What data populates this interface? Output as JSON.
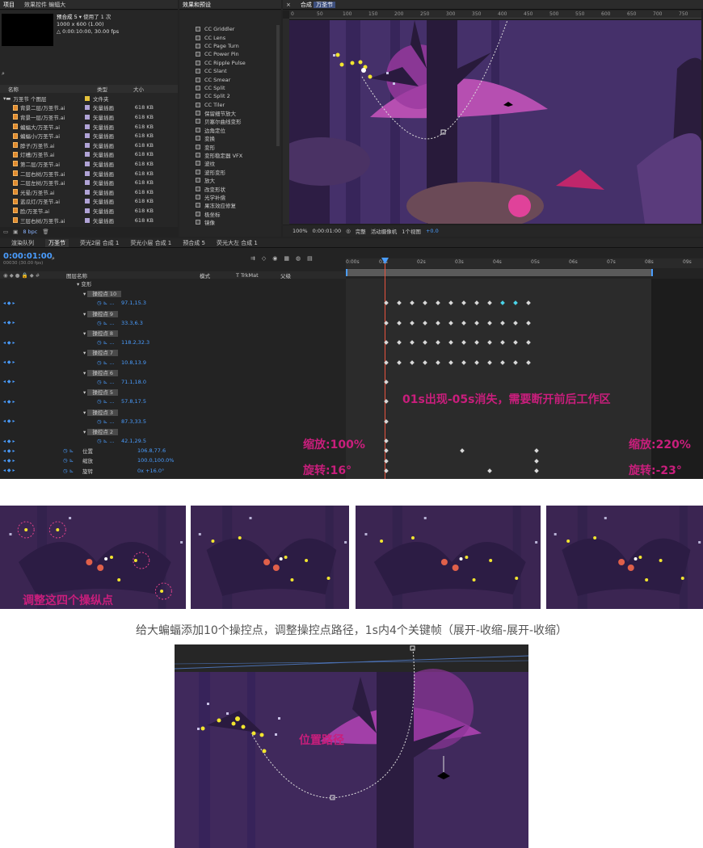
{
  "project_panel": {
    "tabs": [
      "项目",
      "效果控件 蝙蝠大"
    ],
    "preview_title": "预合成 5",
    "preview_used": "使用了 1 次",
    "preview_size": "1000 x 600 (1.00)",
    "preview_duration": "△ 0:00:10:00, 30.00 fps",
    "col_name": "名称",
    "col_type": "类型",
    "col_size": "大小",
    "bpc": "8 bpc",
    "items": [
      {
        "name": "万圣节 个图层",
        "type": "文件夹",
        "size": ""
      },
      {
        "name": "背景二层/万圣节.ai",
        "type": "矢量插画",
        "size": "618 KB"
      },
      {
        "name": "背景一层/万圣节.ai",
        "type": "矢量插画",
        "size": "618 KB"
      },
      {
        "name": "蝙蝠大/万圣节.ai",
        "type": "矢量插画",
        "size": "618 KB"
      },
      {
        "name": "蝙蝠小/万圣节.ai",
        "type": "矢量插画",
        "size": "618 KB"
      },
      {
        "name": "脖子/万圣节.ai",
        "type": "矢量插画",
        "size": "618 KB"
      },
      {
        "name": "灯槽/万圣节.ai",
        "type": "矢量插画",
        "size": "618 KB"
      },
      {
        "name": "第二层/万圣节.ai",
        "type": "矢量插画",
        "size": "618 KB"
      },
      {
        "name": "二层右树/万圣节.ai",
        "type": "矢量插画",
        "size": "618 KB"
      },
      {
        "name": "二层左树/万圣节.ai",
        "type": "矢量插画",
        "size": "618 KB"
      },
      {
        "name": "光晕/万圣节.ai",
        "type": "矢量插画",
        "size": "618 KB"
      },
      {
        "name": "蓝瓜灯/万圣节.ai",
        "type": "矢量插画",
        "size": "618 KB"
      },
      {
        "name": "脸/万圣节.ai",
        "type": "矢量插画",
        "size": "618 KB"
      },
      {
        "name": "三层右树/万圣节.ai",
        "type": "矢量插画",
        "size": "618 KB"
      }
    ]
  },
  "effects_panel": {
    "title": "效果和预设",
    "items": [
      "CC Griddler",
      "CC Lens",
      "CC Page Turn",
      "CC Power Pin",
      "CC Ripple Pulse",
      "CC Slant",
      "CC Smear",
      "CC Split",
      "CC Split 2",
      "CC Tiler",
      "保留细节放大",
      "贝塞尔曲线变形",
      "边角定位",
      "变换",
      "变形",
      "变形稳定器 VFX",
      "波纹",
      "波形变形",
      "放大",
      "改变形状",
      "光学补偿",
      "果冻效应修复",
      "极坐标",
      "镜像"
    ]
  },
  "comp_panel": {
    "tab_label": "合成",
    "comp_name": "万圣节",
    "ruler": [
      "0",
      "50",
      "100",
      "150",
      "200",
      "250",
      "300",
      "350",
      "400",
      "450",
      "500",
      "550",
      "600",
      "650",
      "700",
      "750"
    ],
    "zoom": "100%",
    "timecode": "0:00:01:00",
    "quality": "完整",
    "camera": "活动摄像机",
    "views": "1个视图",
    "exposure": "+0.0"
  },
  "timeline": {
    "tabs": [
      "渲染队列",
      "万圣节",
      "荧光2层 合成 1",
      "荧光小层 合成 1",
      "预合成 5",
      "荧光大左 合成 1"
    ],
    "active_tab": "万圣节",
    "timecode": "0:00:01:00",
    "frame": "00030 (30.00 fps)",
    "col_layer": "图层名称",
    "col_mode": "模式",
    "col_trkmat": "T TrkMat",
    "col_parent": "父级",
    "time_ticks": [
      "0:00s",
      "01s",
      "02s",
      "03s",
      "04s",
      "05s",
      "06s",
      "07s",
      "08s",
      "09s"
    ],
    "transform_label": "变形",
    "rows": [
      {
        "label": "操控点 10",
        "value": "97.1,15.3"
      },
      {
        "label": "操控点 9",
        "value": "33.3,6.3"
      },
      {
        "label": "操控点 8",
        "value": "118.2,32.3"
      },
      {
        "label": "操控点 7",
        "value": "10.8,13.9"
      },
      {
        "label": "操控点 6",
        "value": "71.1,18.0"
      },
      {
        "label": "操控点 5",
        "value": "57.8,17.5"
      },
      {
        "label": "操控点 3",
        "value": "87.3,33.5"
      },
      {
        "label": "操控点 2",
        "value": "42.1,29.5"
      }
    ],
    "position_label": "位置",
    "position_value": "106.8,77.6",
    "scale_label": "缩放",
    "scale_value": "100.0,100.0%",
    "rotation_label": "旋转",
    "rotation_value": "0x +16.0°"
  },
  "annotations": {
    "work_area": "01s出现-05s消失，需要断开前后工作区",
    "scale_start": "缩放:100%",
    "rotate_start": "旋转:16°",
    "scale_end": "缩放:220%",
    "rotate_end": "旋转:-23°",
    "adjust_points": "调整这四个操纵点",
    "caption": "给大蝙蝠添加10个操控点，调整操控点路径，1s内4个关键帧（展开-收缩-展开-收缩）",
    "position_path": "位置路径"
  },
  "colors": {
    "accent_magenta": "#c91e7c",
    "playhead": "#e8533f",
    "timecode_blue": "#4a9dff",
    "scene_purple": "#3b2552"
  }
}
